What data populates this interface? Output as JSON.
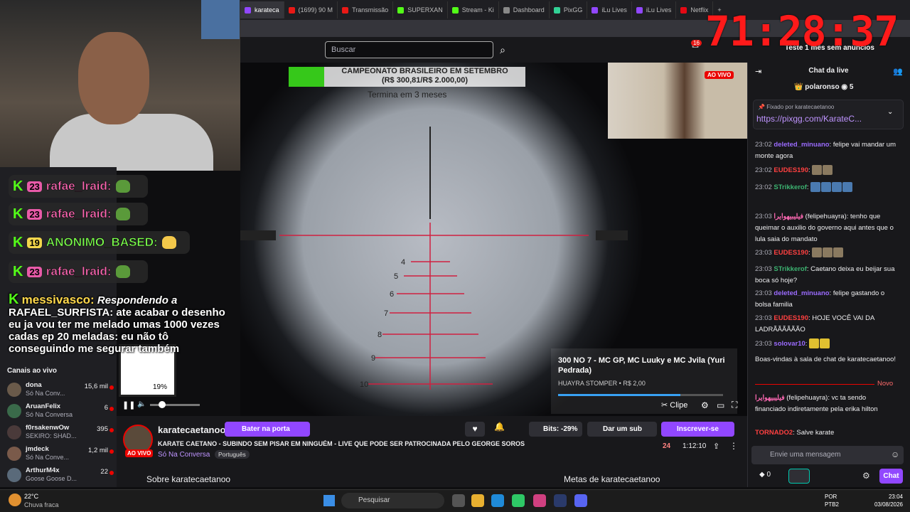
{
  "browser": {
    "tabs": [
      {
        "label": "karateca",
        "active": true
      },
      {
        "label": "(1699) 90 M",
        "active": false
      },
      {
        "label": "Transmissão",
        "active": false
      },
      {
        "label": "SUPERXAN",
        "active": false
      },
      {
        "label": "Stream - Ki",
        "active": false
      },
      {
        "label": "Dashboard",
        "active": false
      },
      {
        "label": "PixGG",
        "active": false
      },
      {
        "label": "iLu Lives",
        "active": false
      },
      {
        "label": "iLu Lives",
        "active": false
      },
      {
        "label": "Netflix",
        "active": false
      }
    ]
  },
  "overlay_timer": "71:28:37",
  "twitch_nav": {
    "search_placeholder": "Buscar",
    "notifications": "16",
    "prime_offer": "Teste 1 mês sem anúncios"
  },
  "stream_overlay": {
    "campeonato_line1": "CAMPEONATO BRASILEIRO EM SETEMBRO",
    "campeonato_line2": "(R$ 300,81/R$ 2.000,00)",
    "termina": "Termina em 3 meses",
    "live_badge": "AO VIVO",
    "qr_percent": "19%",
    "song_title": "300 NO 7 - MC GP, MC Luuky e MC Jvila (Yuri Pedrada)",
    "song_artist": "HUAYRA STOMPER • R$ 2,00",
    "song_progress": 0.74,
    "scope_numbers": [
      "4",
      "5",
      "6",
      "7",
      "8",
      "9",
      "10"
    ]
  },
  "overlay_chat": [
    {
      "name": "rafae_lraid:",
      "badge": "23"
    },
    {
      "name": "rafae_lraid:",
      "badge": "23"
    },
    {
      "name": "ANONIMO_BASED:",
      "badge": "19"
    },
    {
      "name": "rafae_lraid:",
      "badge": "23"
    }
  ],
  "messivasco": {
    "name": "messivasco:",
    "reply": "Respondendo a",
    "text": "RAFAEL_SURFISTA: ate acabar o desenho eu ja vou ter me melado umas 1000 vezes cadas ep 20 meladas: eu não tô conseguindo me segurar também"
  },
  "sidebar": {
    "section_label": "Canais ao vivo",
    "channels": [
      {
        "name": "dona",
        "game": "Só Na Conv...",
        "viewers": "15,6 mil"
      },
      {
        "name": "AruanFelix",
        "game": "Só Na Conversa",
        "viewers": "6"
      },
      {
        "name": "f0rsakenwOw",
        "game": "SEKIRO: SHAD...",
        "viewers": "395"
      },
      {
        "name": "jmdeck",
        "game": "Só Na Conve...",
        "viewers": "1,2 mil"
      },
      {
        "name": "ArthurM4x",
        "game": "Goose Goose D...",
        "viewers": "22"
      }
    ]
  },
  "video_controls": {
    "clip": "Clipe"
  },
  "stream_info": {
    "channel": "karatecaetanoo",
    "raid_button": "Bater na porta",
    "title": "KARATE CAETANO - SUBINDO SEM PISAR EM NINGUÉM - LIVE QUE PODE SER PATROCINADA PELO GEORGE SOROS",
    "category": "Só Na Conversa",
    "language": "Português",
    "live_badge": "AO VIVO",
    "bits": "Bits: -29%",
    "gift_sub": "Dar um sub",
    "subscribe": "Inscrever-se",
    "viewers": "24",
    "uptime": "1:12:10",
    "about": "Sobre karatecaetanoo",
    "goals": "Metas de karatecaetanoo"
  },
  "chat": {
    "header": "Chat da live",
    "top_user": "polaronso",
    "top_count": "5",
    "pinned_by": "Fixado por",
    "pinned_user": "karatecaetanoo",
    "pinned_link": "https://pixgg.com/KarateC...",
    "messages": [
      {
        "time": "23:02",
        "user": "deleted_minuano",
        "color": "#9b6bff",
        "text": "felipe vai mandar um monte agora"
      },
      {
        "time": "23:02",
        "user": "EUDES190",
        "color": "#ff4040",
        "text": ""
      },
      {
        "time": "23:02",
        "user": "STrikkerof",
        "color": "#3cb371",
        "text": ""
      },
      {
        "time": "23:03",
        "user": "فيليبيهوايرا",
        "color": "#ff69b4",
        "text": "(felipehuayra): tenho que queimar o auxilio do governo aqui antes que o lula saia do mandato"
      },
      {
        "time": "23:03",
        "user": "EUDES190",
        "color": "#ff4040",
        "text": ""
      },
      {
        "time": "23:03",
        "user": "STrikkerof",
        "color": "#3cb371",
        "text": "Caetano deixa eu beijar sua boca só hoje?"
      },
      {
        "time": "23:03",
        "user": "deleted_minuano",
        "color": "#9b6bff",
        "text": "felipe gastando o bolsa familia"
      },
      {
        "time": "23:03",
        "user": "EUDES190",
        "color": "#ff4040",
        "text": "HOJE VOCÊ VAI DA LADRÃÃÃÃÃÃO"
      },
      {
        "time": "23:03",
        "user": "solovar10",
        "color": "#9b6bff",
        "text": ""
      }
    ],
    "welcome": "Boas-vindas à sala de chat de karatecaetanoo!",
    "new_label": "Novo",
    "new_messages": [
      {
        "user": "فيليبيهوايرا",
        "color": "#ff69b4",
        "text": "(felipehuayra): vc ta sendo financiado indiretamente pela erika hilton"
      },
      {
        "user": "TORNADO2",
        "color": "#ff4040",
        "text": "Salve karate"
      }
    ],
    "input_placeholder": "Envie uma mensagem",
    "points": "0",
    "send": "Chat"
  },
  "taskbar": {
    "temp": "22°C",
    "weather": "Chuva fraca",
    "search": "Pesquisar",
    "lang1": "POR",
    "lang2": "PTB2",
    "time": "23:04",
    "date": "03/08/2026"
  }
}
